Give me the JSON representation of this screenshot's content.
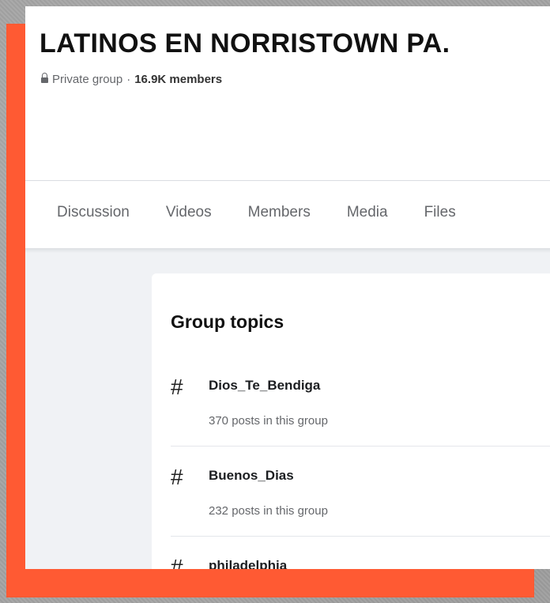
{
  "group": {
    "title": "LATINOS EN NORRISTOWN PA.",
    "privacy": "Private group",
    "separator": "·",
    "members": "16.9K members"
  },
  "tabs": [
    {
      "label": "Discussion"
    },
    {
      "label": "Videos"
    },
    {
      "label": "Members"
    },
    {
      "label": "Media"
    },
    {
      "label": "Files"
    }
  ],
  "topics_card": {
    "title": "Group topics",
    "topics": [
      {
        "icon": "hashtag-icon",
        "hash": "#",
        "name": "Dios_Te_Bendiga",
        "count": "370 posts in this group"
      },
      {
        "icon": "hashtag-icon",
        "hash": "#",
        "name": "Buenos_Dias",
        "count": "232 posts in this group"
      },
      {
        "icon": "hashtag-icon",
        "hash": "#",
        "name": "philadelphia",
        "count": ""
      }
    ]
  },
  "colors": {
    "accent_frame": "#ff5a33",
    "page_bg": "#f0f2f5",
    "secondary_text": "#65676b"
  }
}
